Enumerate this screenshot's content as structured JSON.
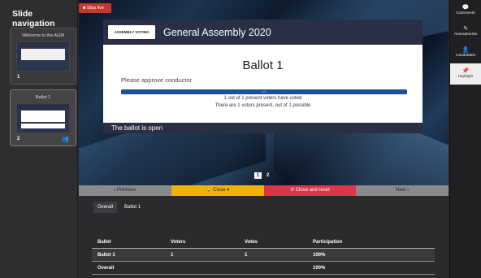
{
  "sidebar": {
    "title": "Slide navigation",
    "slides": [
      {
        "title": "Welcome to the AGM",
        "number": "1"
      },
      {
        "title": "Ballot 1",
        "number": "2",
        "people_icon": "people-icon"
      }
    ]
  },
  "stop_live": "Stop live",
  "card": {
    "logo_text": "ASSEMBLY VOTING",
    "header_title": "General Assembly 2020",
    "ballot_title": "Ballot 1",
    "approve_text": "Please approve conductor",
    "progress_label": "1/1",
    "progress_fraction": 1,
    "voted_line": "1 out of 1 present voters have voted",
    "present_line": "There are 1 voters present, out of 1 possible",
    "status": "The ballot is open"
  },
  "pager": [
    "1",
    "2"
  ],
  "controls": {
    "previous": "‹ Previous",
    "close": "🔒 Close ▾",
    "close_reset": "↺ Close and reset",
    "next": "Next ›"
  },
  "tabs": [
    "Overall",
    "Ballot 1"
  ],
  "table": {
    "headers": [
      "Ballot",
      "Voters",
      "Votes",
      "Participation"
    ],
    "rows": [
      [
        "Ballot 1",
        "1",
        "1",
        "100%"
      ],
      [
        "Overall",
        "",
        "",
        "100%"
      ]
    ]
  },
  "right_sidebar": [
    {
      "label": "Comments",
      "icon": "comment-icon"
    },
    {
      "label": "Amendments",
      "icon": "amendments-icon"
    },
    {
      "label": "Candidates",
      "icon": "person-icon"
    },
    {
      "label": "Highlight",
      "icon": "pin-icon"
    }
  ],
  "colors": {
    "accent_blue": "#1e4e9c",
    "stop_red": "#c8362f",
    "close_yellow": "#f0b400",
    "reset_red": "#d9364a"
  }
}
